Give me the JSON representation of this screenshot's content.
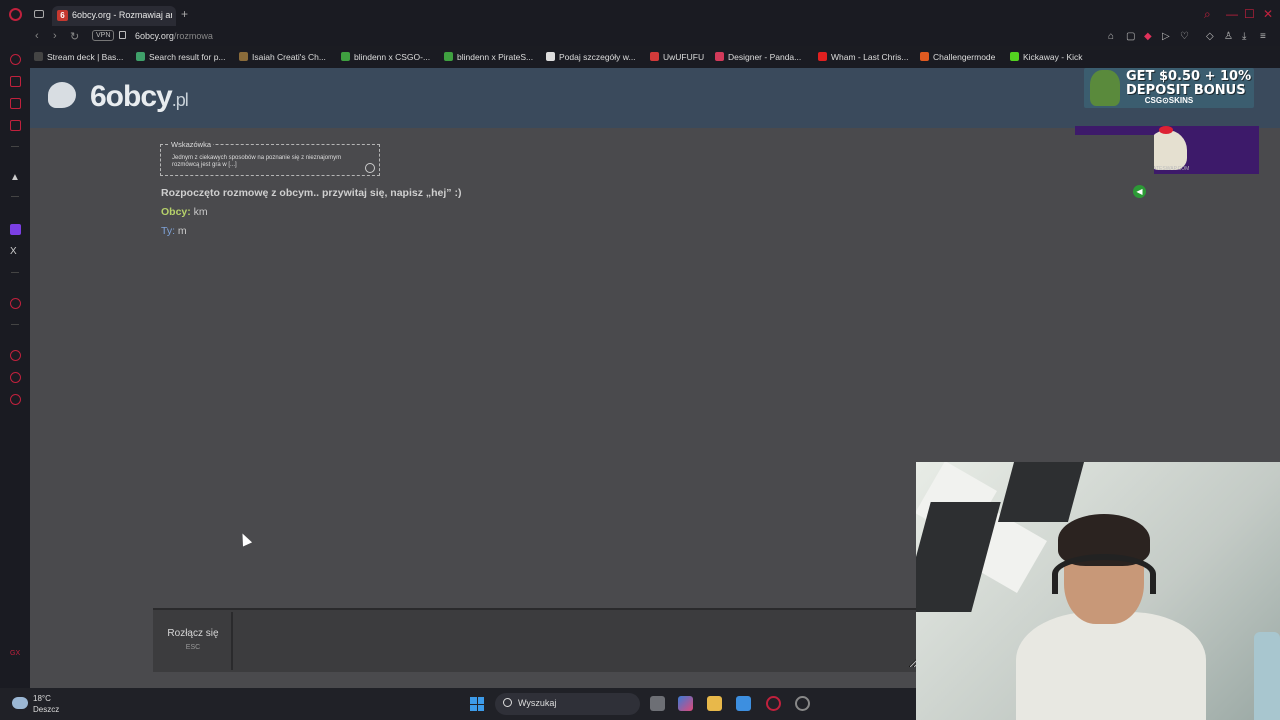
{
  "browser": {
    "tab_title": "6obcy.org - Rozmawiaj an",
    "tab_favicon_letter": "6",
    "new_tab_symbol": "+",
    "vpn_label": "VPN",
    "url_host": "6obcy.org",
    "url_path": "/rozmowa",
    "accent_color": "#c0213d"
  },
  "bookmarks": [
    {
      "label": "Stream deck | Bas...",
      "color": "#444"
    },
    {
      "label": "Search result for p...",
      "color": "#3fa06a"
    },
    {
      "label": "Isaiah Creati's Ch...",
      "color": "#8a6b3a"
    },
    {
      "label": "blindenn x CSGO-...",
      "color": "#3fa040"
    },
    {
      "label": "blindenn x PirateS...",
      "color": "#3fa040"
    },
    {
      "label": "Podaj szczegóły w...",
      "color": "#ddd"
    },
    {
      "label": "UwUFUFU",
      "color": "#d23a3a"
    },
    {
      "label": "Designer - Panda...",
      "color": "#d23a5a"
    },
    {
      "label": "Wham - Last Chris...",
      "color": "#e02020"
    },
    {
      "label": "Challengermode",
      "color": "#e05a20"
    },
    {
      "label": "Kickaway - Kick",
      "color": "#53d320"
    }
  ],
  "site": {
    "logo_main": "6obcy",
    "logo_suffix": ".pl"
  },
  "ads": {
    "top_line1": "GET $0.50 + 10%",
    "top_line2": "DEPOSIT BONUS",
    "top_brand": "CSG⊙SKINS",
    "side_caption": "PIRATESWAP.COM"
  },
  "tip": {
    "title": "Wskazówka",
    "text": "Jednym z ciekawych sposobów na poznanie się z nieznajomym rozmówcą jest gra w [...]"
  },
  "chat": {
    "system_message": "Rozpoczęto rozmowę z obcym.. przywitaj się, napisz „hej” :)",
    "messages": [
      {
        "author": "Obcy:",
        "text": " km"
      },
      {
        "author": "Ty:",
        "text": " m"
      }
    ]
  },
  "controls": {
    "disconnect_label": "Rozłącz się",
    "disconnect_shortcut": "ESC"
  },
  "taskbar": {
    "temperature": "18°C",
    "weather": "Deszcz",
    "search_placeholder": "Wyszukaj"
  }
}
